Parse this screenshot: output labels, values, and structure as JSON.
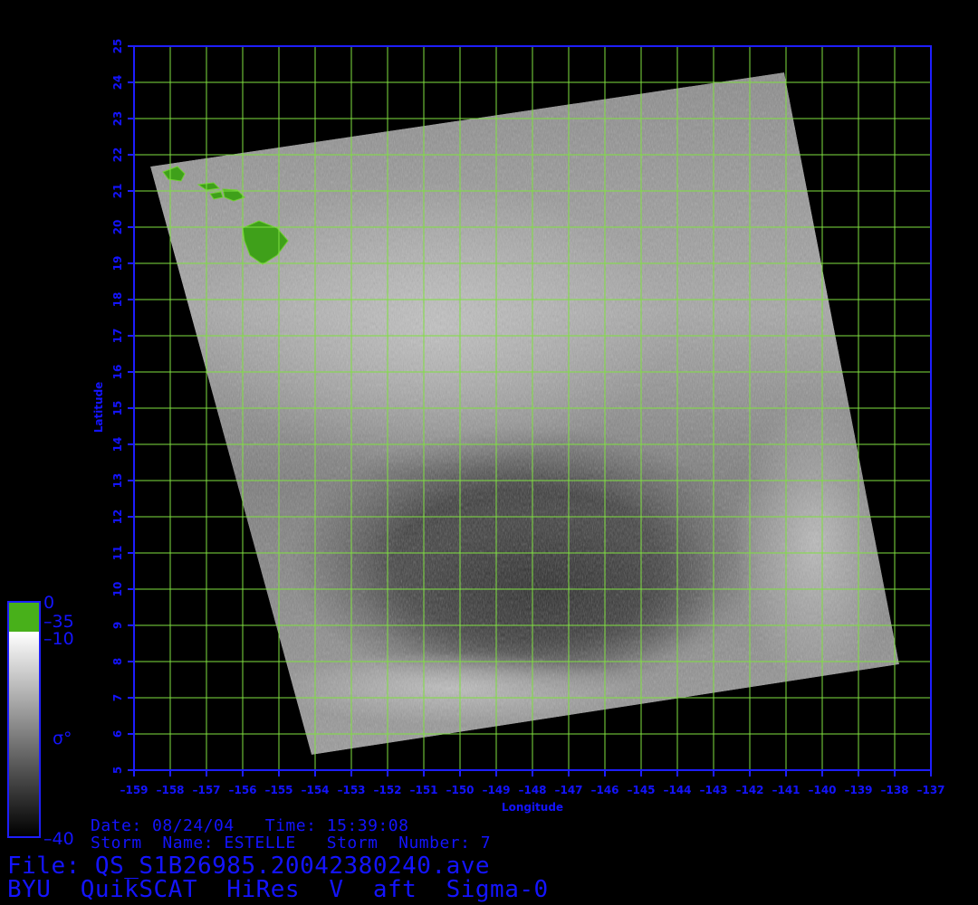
{
  "map": {
    "x_axis_label": "Longitude",
    "y_axis_label": "Latitude",
    "lon_ticks": [
      "-159",
      "-158",
      "-157",
      "-156",
      "-155",
      "-154",
      "-153",
      "-152",
      "-151",
      "-150",
      "-149",
      "-148",
      "-147",
      "-146",
      "-145",
      "-144",
      "-143",
      "-142",
      "-141",
      "-140",
      "-139",
      "-138",
      "-137"
    ],
    "lat_ticks": [
      "5",
      "6",
      "7",
      "8",
      "9",
      "10",
      "11",
      "12",
      "13",
      "14",
      "15",
      "16",
      "17",
      "18",
      "19",
      "20",
      "21",
      "22",
      "23",
      "24",
      "25"
    ],
    "lon_range": [
      -159,
      -137
    ],
    "lat_range": [
      5,
      25
    ],
    "grid_color": "#7fe040",
    "frame_color": "#1e1eff",
    "land_color": "#3fa01a",
    "features": [
      "hawaiian-islands",
      "storm-estelle-low-backscatter"
    ]
  },
  "colorbar": {
    "labels": [
      "0",
      "-35",
      "-10",
      "-40"
    ],
    "symbol": "σ°",
    "land_color": "#48b01a"
  },
  "info": {
    "date_line": "Date: 08/24/04   Time: 15:39:08",
    "storm_line": "Storm  Name: ESTELLE   Storm  Number: 7",
    "file_line": "File: QS_S1B26985.20042380240.ave",
    "product_line": "BYU  QuikSCAT  HiRes  V  aft  Sigma-0"
  }
}
